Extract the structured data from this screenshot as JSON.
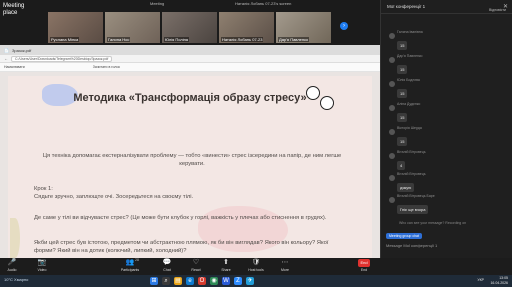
{
  "app": {
    "brand_line1": "Meeting",
    "brand_line2": "place",
    "top_title": "Meeting",
    "viewing_label": "Наталія Лобань 07-23's screen"
  },
  "participants": [
    {
      "name": "Руслана Мінка"
    },
    {
      "name": "Галина Нос"
    },
    {
      "name": "Юлія Поліна"
    },
    {
      "name": "Наталія Лобань 07-23"
    },
    {
      "name": "Дар'я Павленко"
    }
  ],
  "shared_window": {
    "file_name": "Зразок.pdf",
    "address": "C:/Users/User/Downloads/Telegram%20Desktop/Зразок.pdf",
    "toolbar_left": "Намалювати",
    "toolbar_center": "Зачитати в голос"
  },
  "document": {
    "title": "Методика «Трансформація образу стресу»",
    "lead": "Ця техніка допомагає екстерналізувати проблему — тобто «винести» стрес ізсередини на папір, де ним легше керувати.",
    "step_label": "Крок 1:",
    "step_text": "Сядьте зручно, заплющте очі. Зосередьтеся на своєму тілі.",
    "q1": "Де саме у тілі ви відчуваєте стрес? (Це може бути клубок у горлі, важкість у плечах або стиснення в грудях).",
    "q2": "Якби цей стрес був істотою, предметом чи абстрактною плямою, як би він виглядав? Якого він кольору? Якої форми? Який він на дотик (колючий, липкий, холодний)?"
  },
  "chat": {
    "title": "Мої конференції 1",
    "subtitle": "Відповісти",
    "messages": [
      {
        "who": "Галина Іванівна",
        "text": "15"
      },
      {
        "who": "Дар'я Павленко",
        "text": "15"
      },
      {
        "who": "Юлія Бодлєва",
        "text": "15"
      },
      {
        "who": "Аліна Дудєнко",
        "text": "15"
      },
      {
        "who": "Вікторія Шерда",
        "text": "15"
      },
      {
        "who": "Віталій Вітровець",
        "text": "4"
      },
      {
        "who": "Віталій Вітровець",
        "text": "дякую"
      },
      {
        "who": "Віталій Вітровець Баре",
        "text": "Гніє ще вчора"
      }
    ],
    "note": "Who can see your message? Recording on",
    "to_label": "Meeting group chat",
    "input_placeholder": "Message Мої конференції 1"
  },
  "controls": [
    {
      "label": "Audio",
      "icon": "🎤"
    },
    {
      "label": "Video",
      "icon": "📷"
    },
    {
      "label": "Participants",
      "icon": "👥"
    },
    {
      "label": "Chat",
      "icon": "💬"
    },
    {
      "label": "React",
      "icon": "♡"
    },
    {
      "label": "Share",
      "icon": "⬆"
    },
    {
      "label": "Host tools",
      "icon": "🛡"
    },
    {
      "label": "More",
      "icon": "⋯"
    },
    {
      "label": "End",
      "icon": "End"
    }
  ],
  "participants_count": "28",
  "taskbar": {
    "weather": "10°C Хмарно",
    "lang": "УКР",
    "time": "13:05",
    "date": "16.04.2026"
  },
  "colors": {
    "accent": "#1e7cf0",
    "end": "#e0322f",
    "page_bg": "#f3e7e4"
  }
}
